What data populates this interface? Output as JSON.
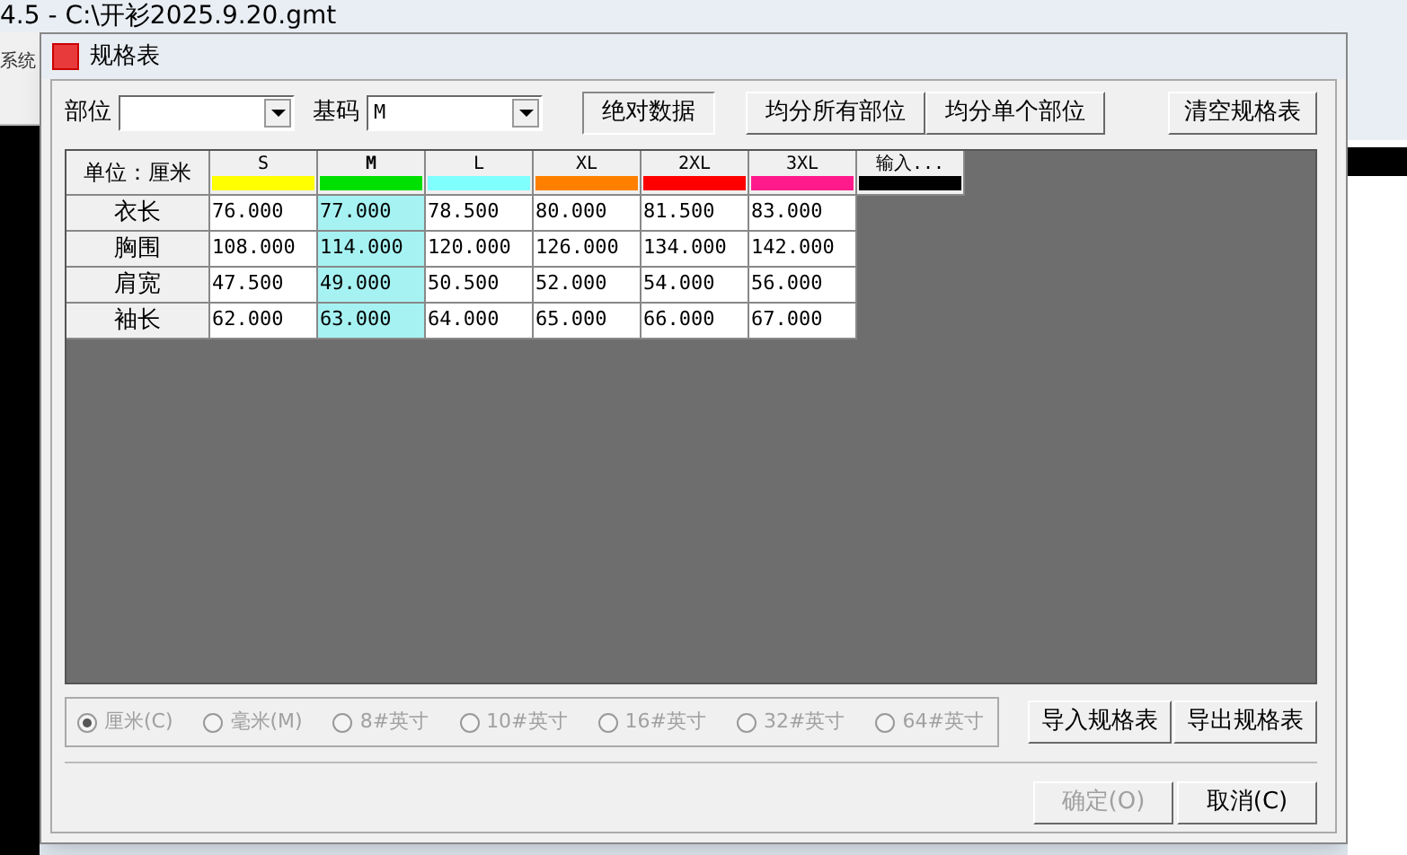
{
  "app": {
    "title": "4.5 - C:\\开衫2025.9.20.gmt",
    "menu_partial": "系统"
  },
  "window": {
    "title": "规格表"
  },
  "fields": [
    {
      "label": "部位"
    },
    {
      "label": "基码",
      "value": "M"
    }
  ],
  "top_buttons": [
    {
      "label": "绝对数据",
      "pressed": true
    },
    {
      "label": "均分所有部位",
      "pressed": false
    },
    {
      "label": "均分单个部位",
      "pressed": false
    }
  ],
  "clear_button": "清空规格表",
  "table": {
    "unit_label": "单位：厘米",
    "columns": [
      {
        "label": "S",
        "color": "#ffff00",
        "selected": false
      },
      {
        "label": "M",
        "color": "#00e000",
        "selected": true
      },
      {
        "label": "L",
        "color": "#80ffff",
        "selected": false
      },
      {
        "label": "XL",
        "color": "#ff8000",
        "selected": false
      },
      {
        "label": "2XL",
        "color": "#ff0000",
        "selected": false
      },
      {
        "label": "3XL",
        "color": "#ff1a8c",
        "selected": false
      },
      {
        "label": "输入...",
        "color": "#000000",
        "selected": false
      }
    ],
    "rows": [
      {
        "label": "衣长",
        "cells": [
          "76.000",
          "77.000",
          "78.500",
          "80.000",
          "81.500",
          "83.000"
        ]
      },
      {
        "label": "胸围",
        "cells": [
          "108.000",
          "114.000",
          "120.000",
          "126.000",
          "134.000",
          "142.000"
        ]
      },
      {
        "label": "肩宽",
        "cells": [
          "47.500",
          "49.000",
          "50.500",
          "52.000",
          "54.000",
          "56.000"
        ]
      },
      {
        "label": "袖长",
        "cells": [
          "62.000",
          "63.000",
          "64.000",
          "65.000",
          "66.000",
          "67.000"
        ]
      }
    ]
  },
  "units": [
    {
      "label": "厘米(C)",
      "selected": true,
      "disabled": true
    },
    {
      "label": "毫米(M)",
      "selected": false,
      "disabled": true
    },
    {
      "label": "8#英寸",
      "selected": false,
      "disabled": true
    },
    {
      "label": "10#英寸",
      "selected": false,
      "disabled": true
    },
    {
      "label": "16#英寸",
      "selected": false,
      "disabled": true
    },
    {
      "label": "32#英寸",
      "selected": false,
      "disabled": true
    },
    {
      "label": "64#英寸",
      "selected": false,
      "disabled": true
    }
  ],
  "file_buttons": [
    {
      "label": "导入规格表"
    },
    {
      "label": "导出规格表"
    }
  ],
  "dialog_buttons": [
    {
      "label": "确定(O)",
      "disabled": true
    },
    {
      "label": "取消(C)",
      "disabled": false
    }
  ]
}
